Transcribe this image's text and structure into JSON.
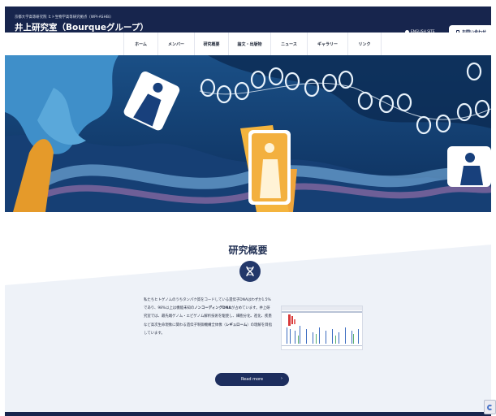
{
  "header": {
    "affiliation": "京都大学高等研究院 ヒト生物学高等研究拠点（WPI-ASHBi）",
    "lab_title": "井上研究室（Bourqueグループ）",
    "english_site": "ENGLISH SITE",
    "contact": "お問い合わせ"
  },
  "nav": {
    "items": [
      {
        "label": "ホーム"
      },
      {
        "label": "メンバー"
      },
      {
        "label": "研究概要"
      },
      {
        "label": "論文・出版物"
      },
      {
        "label": "ニュース"
      },
      {
        "label": "ギャラリー"
      },
      {
        "label": "リンク"
      }
    ]
  },
  "overview": {
    "title": "研究概要",
    "body_1": "私たちヒトゲノムのうちタンパク質をコードしている遺伝子DNAはわずか1.5%であり、98%以上は機能未知の",
    "body_bold_1": "ノンコーディングDNA",
    "body_2": "が占めています。井上研究室では、最先端ゲノム・エピゲノム解析技術を駆使し、細胞分化、進化、疾患など高次生命現象に関わる遺伝子制御機構全体像（",
    "body_bold_2": "レギュローム",
    "body_3": "）の理解を目指しています。",
    "read_more": "Read more",
    "read_more_arrow": "›"
  },
  "colors": {
    "header_navy": "#17254d",
    "accent_navy": "#1d2e5e",
    "hero_blue": "#10386a"
  },
  "icons": [
    "globe-icon",
    "phone-icon",
    "dna-icon",
    "recaptcha-icon"
  ]
}
